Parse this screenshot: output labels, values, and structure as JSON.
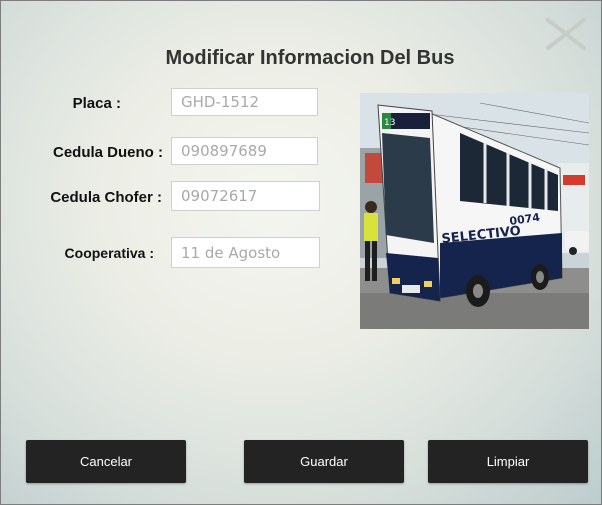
{
  "window": {
    "title": "Modificar Informacion Del Bus"
  },
  "form": {
    "placa": {
      "label": "Placa :",
      "value": "GHD-1512"
    },
    "cedula_dueno": {
      "label": "Cedula Dueno :",
      "value": "090897689"
    },
    "cedula_chofer": {
      "label": "Cedula Chofer :",
      "value": "09072617"
    },
    "cooperativa": {
      "label": "Cooperativa :",
      "value": "11 de Agosto"
    }
  },
  "photo": {
    "route_number": "13",
    "brand_text": "SELECTIVO",
    "fleet_number": "0074"
  },
  "buttons": {
    "cancel": "Cancelar",
    "save": "Guardar",
    "clear": "Limpiar"
  },
  "icons": {
    "close": "close-icon"
  }
}
